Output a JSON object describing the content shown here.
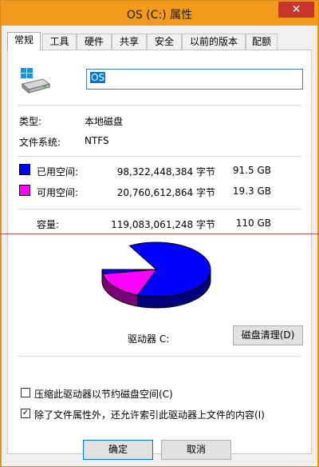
{
  "window": {
    "title": "OS (C:) 属性",
    "close_glyph": "✕"
  },
  "tabs": [
    {
      "label": "常规"
    },
    {
      "label": "工具"
    },
    {
      "label": "硬件"
    },
    {
      "label": "共享"
    },
    {
      "label": "安全"
    },
    {
      "label": "以前的版本"
    },
    {
      "label": "配额"
    }
  ],
  "drive": {
    "icon": "drive-icon",
    "name": "OS"
  },
  "info": {
    "type_label": "类型:",
    "type_value": "本地磁盘",
    "fs_label": "文件系统:",
    "fs_value": "NTFS"
  },
  "usage": {
    "used": {
      "label": "已用空间:",
      "bytes": "98,322,448,384 字节",
      "size": "91.5 GB",
      "color": "#0000ff",
      "fraction": 0.832
    },
    "free": {
      "label": "可用空间:",
      "bytes": "20,760,612,864 字节",
      "size": "19.3 GB",
      "color": "#ff00ff",
      "fraction": 0.168
    },
    "capacity": {
      "label": "容量:",
      "bytes": "119,083,061,248 字节",
      "size": "110 GB"
    }
  },
  "chart": {
    "drive_label": "驱动器 C:"
  },
  "buttons": {
    "cleanup": "磁盘清理(D)",
    "ok": "确定",
    "cancel": "取消"
  },
  "options": {
    "compress": {
      "label": "压缩此驱动器以节约磁盘空间(C)",
      "checked": false
    },
    "index": {
      "label": "除了文件属性外，还允许索引此驱动器上文件的内容(I)",
      "checked": true
    }
  },
  "colors": {
    "accent": "#f39a1c",
    "used": "#0000ff",
    "free": "#ff00ff"
  }
}
